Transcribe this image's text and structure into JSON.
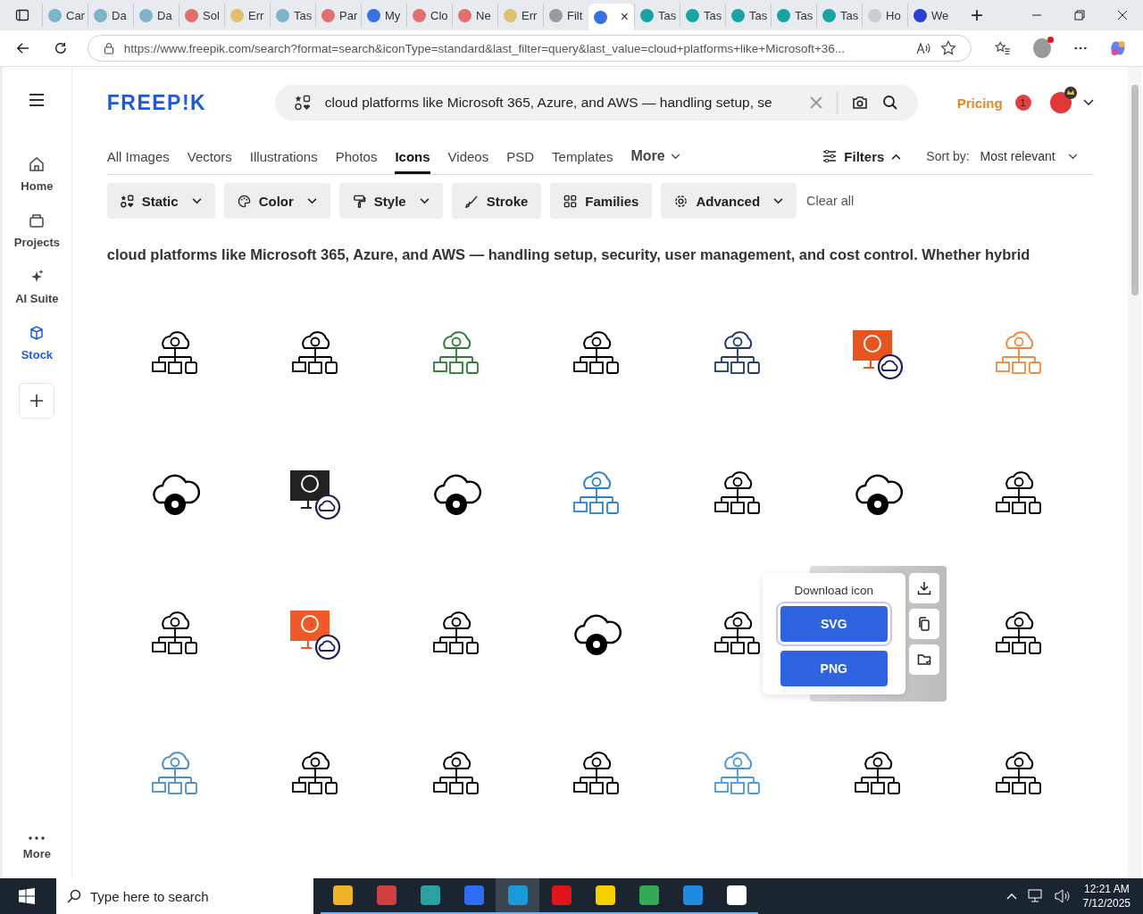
{
  "browser": {
    "tabs": [
      {
        "label": "Car",
        "color": "#7fb3c8",
        "selected": false
      },
      {
        "label": "Da",
        "color": "#7fb3c8",
        "selected": false
      },
      {
        "label": "Da",
        "color": "#7fb3c8",
        "selected": false
      },
      {
        "label": "Sol",
        "color": "#e07070",
        "selected": false
      },
      {
        "label": "Err",
        "color": "#e0c070",
        "selected": false
      },
      {
        "label": "Tas",
        "color": "#7fb3c8",
        "selected": false
      },
      {
        "label": "Par",
        "color": "#e07070",
        "selected": false
      },
      {
        "label": "My",
        "color": "#3a6fe0",
        "selected": false
      },
      {
        "label": "Clo",
        "color": "#e07070",
        "selected": false
      },
      {
        "label": "Ne",
        "color": "#e07070",
        "selected": false
      },
      {
        "label": "Err",
        "color": "#e0c070",
        "selected": false
      },
      {
        "label": "Filt",
        "color": "#9a9a9a",
        "selected": false
      },
      {
        "color": "#3a6fe0",
        "selected": true
      },
      {
        "label": "Tas",
        "color": "#1aa3a3",
        "selected": false
      },
      {
        "label": "Tas",
        "color": "#1aa3a3",
        "selected": false
      },
      {
        "label": "Tas",
        "color": "#1aa3a3",
        "selected": false
      },
      {
        "label": "Tas",
        "color": "#1aa3a3",
        "selected": false
      },
      {
        "label": "Tas",
        "color": "#1aa3a3",
        "selected": false
      },
      {
        "label": "Ho",
        "color": "#cccccc",
        "selected": false
      },
      {
        "label": "We",
        "color": "#2a3fd0",
        "selected": false
      }
    ],
    "close_glyph": "×",
    "new_tab_glyph": "+",
    "url": "https://www.freepik.com/search?format=search&iconType=standard&last_filter=query&last_value=cloud+platforms+like+Microsoft+36..."
  },
  "sidebar": {
    "items": [
      {
        "kind": "home",
        "label": "Home",
        "selected": false
      },
      {
        "kind": "projects",
        "label": "Projects",
        "selected": false
      },
      {
        "kind": "ai",
        "label": "AI Suite",
        "selected": false
      },
      {
        "kind": "stock",
        "label": "Stock",
        "selected": true
      }
    ],
    "more": "More"
  },
  "header": {
    "logo": "FREEP!K",
    "search": {
      "value": "cloud platforms like Microsoft 365, Azure, and AWS — handling setup, se"
    },
    "pricing": "Pricing",
    "notifications": "1"
  },
  "categories": [
    {
      "label": "All Images",
      "selected": false
    },
    {
      "label": "Vectors",
      "selected": false
    },
    {
      "label": "Illustrations",
      "selected": false
    },
    {
      "label": "Photos",
      "selected": false
    },
    {
      "label": "Icons",
      "selected": true
    },
    {
      "label": "Videos",
      "selected": false
    },
    {
      "label": "PSD",
      "selected": false
    },
    {
      "label": "Templates",
      "selected": false
    }
  ],
  "more_tab": "More",
  "filters": {
    "label": "Filters",
    "expanded": true
  },
  "sort": {
    "label": "Sort by:",
    "value": "Most relevant"
  },
  "filter_chips": [
    {
      "kind": "static",
      "label": "Static",
      "dropdown": true
    },
    {
      "kind": "color",
      "label": "Color",
      "dropdown": true
    },
    {
      "kind": "style",
      "label": "Style",
      "dropdown": true
    },
    {
      "kind": "stroke",
      "label": "Stroke",
      "dropdown": false
    },
    {
      "kind": "families",
      "label": "Families",
      "dropdown": false
    },
    {
      "kind": "advanced",
      "label": "Advanced",
      "dropdown": true
    }
  ],
  "clear_all": "Clear all",
  "query_heading": "cloud platforms like Microsoft 365, Azure, and AWS — handling setup, security, user management, and cost control. Whether hybrid",
  "results": [
    {
      "kind": "line",
      "color": "#000000"
    },
    {
      "kind": "line",
      "color": "#000000"
    },
    {
      "kind": "line",
      "color": "#2e7d32"
    },
    {
      "kind": "line",
      "color": "#000000"
    },
    {
      "kind": "line",
      "color": "#1e3a6e"
    },
    {
      "kind": "badge",
      "color": "#e8541e"
    },
    {
      "kind": "line",
      "color": "#f08a3c"
    },
    {
      "kind": "solid",
      "color": "#000000"
    },
    {
      "kind": "badge",
      "color": "#222222"
    },
    {
      "kind": "solid",
      "color": "#000000"
    },
    {
      "kind": "line",
      "color": "#2a84c8"
    },
    {
      "kind": "line",
      "color": "#000000"
    },
    {
      "kind": "solid",
      "color": "#000000"
    },
    {
      "kind": "line",
      "color": "#000000"
    },
    {
      "kind": "line",
      "color": "#000000"
    },
    {
      "kind": "badge",
      "color": "#f05a28"
    },
    {
      "kind": "line",
      "color": "#000000"
    },
    {
      "kind": "solid",
      "color": "#000000"
    },
    {
      "kind": "line",
      "color": "#000000"
    },
    {
      "kind": "covered"
    },
    {
      "kind": "line",
      "color": "#000000"
    },
    {
      "kind": "line",
      "color": "#4a90c8"
    },
    {
      "kind": "line",
      "color": "#000000"
    },
    {
      "kind": "line",
      "color": "#000000"
    },
    {
      "kind": "line",
      "color": "#000000"
    },
    {
      "kind": "line",
      "color": "#4a9ad8"
    },
    {
      "kind": "line",
      "color": "#000000"
    },
    {
      "kind": "line",
      "color": "#000000"
    }
  ],
  "download_menu": {
    "title": "Download icon",
    "formats": [
      "SVG",
      "PNG"
    ],
    "actions": [
      {
        "kind": "download"
      },
      {
        "kind": "copy"
      },
      {
        "kind": "folder"
      }
    ]
  },
  "taskbar": {
    "search_placeholder": "Type here to search",
    "apps": [
      {
        "color": "#f0b429",
        "selected": false
      },
      {
        "color": "#d04040",
        "selected": false
      },
      {
        "color": "#2aa0a0",
        "selected": false
      },
      {
        "color": "#2d6cf0",
        "selected": false
      },
      {
        "color": "#1a9ad8",
        "selected": true
      },
      {
        "color": "#e0151b",
        "selected": false
      },
      {
        "color": "#f5d000",
        "selected": false
      },
      {
        "color": "#34a853",
        "selected": false
      },
      {
        "color": "#1f8ae0",
        "selected": false
      },
      {
        "color": "#ffffff",
        "selected": false
      }
    ],
    "time": "12:21 AM",
    "date": "7/12/2025"
  }
}
